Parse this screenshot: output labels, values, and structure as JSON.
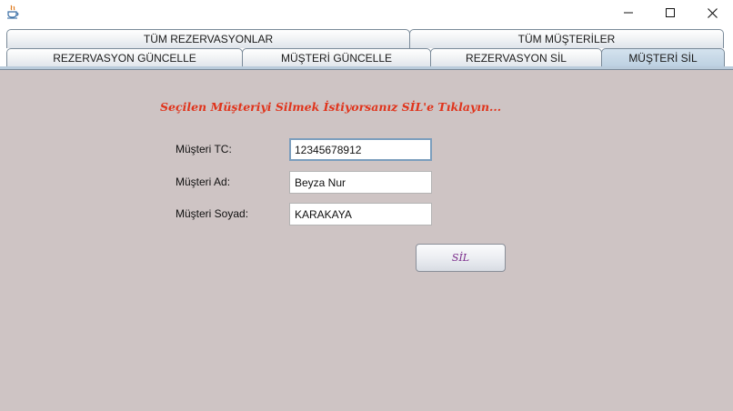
{
  "window": {
    "icons": {
      "app": "java-coffee-cup-icon",
      "minimize": "minimize-icon",
      "maximize": "maximize-icon",
      "close": "close-icon"
    }
  },
  "tabs": {
    "row_top": [
      {
        "label": "TÜM REZERVASYONLAR"
      },
      {
        "label": "TÜM MÜŞTERİLER"
      }
    ],
    "row_bottom": [
      {
        "label": "REZERVASYON GÜNCELLE"
      },
      {
        "label": "MÜŞTERİ GÜNCELLE"
      },
      {
        "label": "REZERVASYON SİL"
      },
      {
        "label": "MÜŞTERİ SİL",
        "selected": true
      }
    ]
  },
  "form": {
    "heading": "Seçilen Müşteriyi Silmek İstiyorsanız SİL'e Tıklayın...",
    "tc_label": "Müşteri TC:",
    "tc_value": "12345678912",
    "ad_label": "Müşteri Ad:",
    "ad_value": "Beyza Nur",
    "soyad_label": "Müşteri Soyad:",
    "soyad_value": "KARAKAYA",
    "sil_label": "SİL"
  },
  "colors": {
    "background": "#cec4c4",
    "heading": "#e0341c",
    "button_text": "#7a2a8a",
    "selected_tab": "#bcd0e1"
  }
}
